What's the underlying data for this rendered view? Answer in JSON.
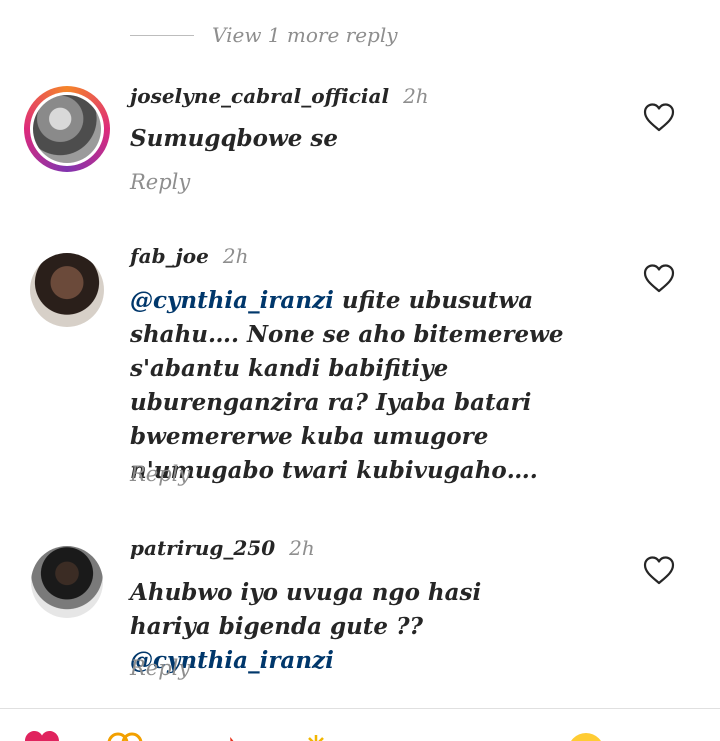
{
  "more_replies": {
    "label": "View 1 more reply"
  },
  "comments": [
    {
      "username": "joselyne_cabral_official",
      "time": "2h",
      "text": "Sumugqbowe se",
      "reply_label": "Reply"
    },
    {
      "username": "fab_joe",
      "time": "2h",
      "mention": "@cynthia_iranzi",
      "text": "  ufite ubusutwa shahu…. None se aho bitemerewe s'abantu kandi babifitiye uburenganzira ra? Iyaba batari bwemererwe kuba umugore n'umugabo twari kubivugaho….",
      "reply_label": "Reply"
    },
    {
      "username": "patrirug_250",
      "time": "2h",
      "text": "Ahubwo iyo uvuga ngo hasi hariya bigenda gute ?? ",
      "mention": "@cynthia_iranzi",
      "reply_label": "Reply"
    }
  ],
  "icons": {
    "like": "heart-outline-icon",
    "reactions": [
      "heart-emoji",
      "clapping-emoji",
      "fire-emoji",
      "sparkle-emoji",
      "smile-emoji"
    ]
  },
  "colors": {
    "mention": "#00376b",
    "secondary_text": "#8e8e8e",
    "story_ring": [
      "#f58529",
      "#dd2a7b",
      "#8134af"
    ]
  }
}
